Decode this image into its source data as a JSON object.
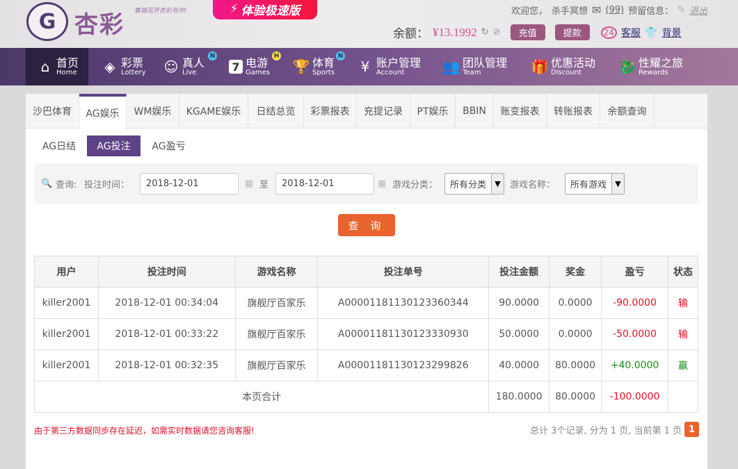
{
  "header": {
    "logo_text": "杏彩",
    "slogan": "春城花开杏彩有你!",
    "speed_label": "体验极速版",
    "welcome": "欢迎您，",
    "username": "杀手冥想",
    "messages": "(99)",
    "reserved_info": "预留信息：",
    "logout": "退出",
    "balance_label": "余额：",
    "balance": "¥13.1992",
    "deposit": "充值",
    "withdraw": "提款",
    "service": "客服",
    "background": "背景"
  },
  "nav": [
    {
      "cn": "首页",
      "en": "Home"
    },
    {
      "cn": "彩票",
      "en": "Lottery"
    },
    {
      "cn": "真人",
      "en": "Live",
      "badge": "N"
    },
    {
      "cn": "电游",
      "en": "Games",
      "badge": "H"
    },
    {
      "cn": "体育",
      "en": "Sports",
      "badge": "N"
    },
    {
      "cn": "账户管理",
      "en": "Account"
    },
    {
      "cn": "团队管理",
      "en": "Team"
    },
    {
      "cn": "优惠活动",
      "en": "Discount"
    },
    {
      "cn": "性耀之旅",
      "en": "Rewards"
    }
  ],
  "tabs": [
    "沙巴体育",
    "AG娱乐",
    "WM娱乐",
    "KGAME娱乐",
    "日结总览",
    "彩票报表",
    "充提记录",
    "PT娱乐",
    "BBIN",
    "账变报表",
    "转账报表",
    "余额查询"
  ],
  "subtabs": [
    "AG日结",
    "AG投注",
    "AG盈亏"
  ],
  "filter": {
    "query": "查询:",
    "bet_time": "投注时间：",
    "from": "2018-12-01",
    "to_label": "至",
    "to": "2018-12-01",
    "category_label": "游戏分类：",
    "category": "所有分类",
    "game_label": "游戏名称：",
    "game": "所有游戏",
    "submit": "查 询"
  },
  "table": {
    "headers": [
      "用户",
      "投注时间",
      "游戏名称",
      "投注单号",
      "投注金额",
      "奖金",
      "盈亏",
      "状态"
    ],
    "rows": [
      [
        "killer2001",
        "2018-12-01 00:34:04",
        "旗舰厅百家乐",
        "A00001181130123360344",
        "90.0000",
        "0.0000",
        "-90.0000",
        "输"
      ],
      [
        "killer2001",
        "2018-12-01 00:33:22",
        "旗舰厅百家乐",
        "A00001181130123330930",
        "50.0000",
        "0.0000",
        "-50.0000",
        "输"
      ],
      [
        "killer2001",
        "2018-12-01 00:32:35",
        "旗舰厅百家乐",
        "A00001181130123299826",
        "40.0000",
        "80.0000",
        "+40.0000",
        "赢"
      ]
    ],
    "total": {
      "label": "本页合计",
      "amount": "180.0000",
      "bonus": "80.0000",
      "profit": "-100.0000"
    }
  },
  "notice": "由于第三方数据同步存在延迟，如需实时数据请您咨询客服!",
  "pager": {
    "summary": "总计 3个记录, 分为 1 页, 当前第 1 页",
    "current": "1"
  }
}
